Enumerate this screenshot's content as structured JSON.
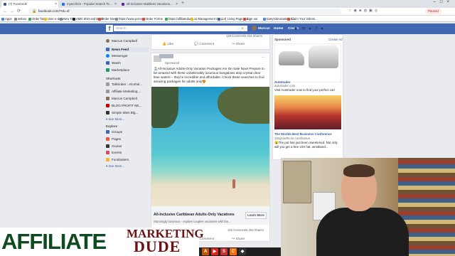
{
  "browser": {
    "tabs": [
      {
        "label": "(7) Facebook",
        "color": "#3b5998"
      },
      {
        "label": "myeeches - Popular Search Te...",
        "color": "#1a73e8"
      },
      {
        "label": "all-inclusive Maldives vacations...",
        "color": "#6a1b9a"
      }
    ],
    "url": "facebook.com/?sk=nf",
    "paused_label": "Paused",
    "bookmarks": [
      {
        "label": "Apps",
        "color": "#4285f4"
      },
      {
        "label": "webox",
        "color": "#888"
      },
      {
        "label": "Order Now",
        "color": "#34a853"
      },
      {
        "label": "User e-data",
        "color": "#fbbc05"
      },
      {
        "label": "New Tab",
        "color": "#888"
      },
      {
        "label": "AMD Shirt and Book",
        "color": "#222"
      },
      {
        "label": "Order Now",
        "color": "#ea4335"
      },
      {
        "label": "https://www.pcmon...",
        "color": "#888"
      },
      {
        "label": "Order Forms",
        "color": "#ea4335"
      },
      {
        "label": "https://affiliatedude...",
        "color": "#34a853"
      },
      {
        "label": "11 Management Co...",
        "color": "#fbbc05"
      },
      {
        "label": "(14) Living Page Bui...",
        "color": "#4267b2"
      },
      {
        "label": "Sign out",
        "color": "#ea4335"
      },
      {
        "label": "EasyVideoSuite » A...",
        "color": "#4285f4"
      },
      {
        "label": "Claim Your Videos...",
        "color": "#ea4335"
      }
    ]
  },
  "fb": {
    "logo": "f",
    "search_placeholder": "Search",
    "user": "Marcus",
    "home": "Home",
    "create": "Create"
  },
  "sidebar": {
    "user": "Marcus Campbell",
    "items": [
      {
        "label": "News Feed",
        "color": "#4267b2"
      },
      {
        "label": "Messenger",
        "color": "#0084ff"
      },
      {
        "label": "Watch",
        "color": "#4267b2"
      },
      {
        "label": "Marketplace",
        "color": "#1a9e6e"
      }
    ],
    "shortcuts_header": "Shortcuts",
    "shortcuts": [
      {
        "label": "TalkSober - Alcohol...",
        "color": "#9a9a9a"
      },
      {
        "label": "Affiliate Marketing ...",
        "color": "#9a9a9a"
      },
      {
        "label": "Marcus Campbell",
        "color": "#8a6f5a"
      },
      {
        "label": "BLOG PROFIT NE...",
        "color": "#c00"
      },
      {
        "label": "Simple Sites Blg...",
        "color": "#333"
      }
    ],
    "see_more_1": "See More...",
    "explore_header": "Explore",
    "explore": [
      {
        "label": "Groups",
        "color": "#4267b2"
      },
      {
        "label": "Pages",
        "color": "#f5533d"
      },
      {
        "label": "Oculus",
        "color": "#333"
      },
      {
        "label": "Events",
        "color": "#e4405f"
      },
      {
        "label": "Fundraisers",
        "color": "#f7b928"
      }
    ],
    "see_more_2": "See More..."
  },
  "card0": {
    "stats": "128 Comments  234 Shares",
    "like": "Like",
    "comment": "Comment",
    "share": "Share"
  },
  "post": {
    "sponsored": "Sponsored",
    "text": "🏝️All-Inclusive Adults-Only Vacation Packages Are On Sale Now! Prepare to be amazed with these unbelievably luxurious bungalows atop crystal clear blue waters – they're incredible and affordable. Check these searches to find amazing packages for adults only😍",
    "link_title": "All-Inclusive Caribbean Adults-Only Vacations",
    "link_desc": "Stunningly luxurious - explore couples vacations with the...",
    "cta": "Learn More",
    "stats": "102 Comments  284 Shares",
    "like": "Like",
    "comment": "Comment",
    "share": "Share"
  },
  "sponsored_col": {
    "header": "Sponsored",
    "create_ad": "Create Ad",
    "ad1_title": "Autotrader",
    "ad1_domain": "autotrader.com",
    "ad1_desc": "Visit Autotrader now to find your perfect car!",
    "ad2_title": "The Worlds Best Business Conference",
    "ad2_domain": "10xgrowthcon.com/bonus",
    "ad2_desc1": "😮The pot has just been sweetened. Not only",
    "ad2_desc2": "will you get a free 10X hat, wristband..."
  },
  "overlay": {
    "line1": "AFFILIATE",
    "line2": "MARKETING",
    "line3": "DUDE"
  },
  "taskbar": [
    {
      "glyph": "A",
      "color": "#c45500"
    },
    {
      "glyph": "▶",
      "color": "#e62117"
    },
    {
      "glyph": "S",
      "color": "#d32f2f"
    },
    {
      "glyph": "C",
      "color": "#ff6d00"
    },
    {
      "glyph": "◆",
      "color": "#333"
    }
  ]
}
